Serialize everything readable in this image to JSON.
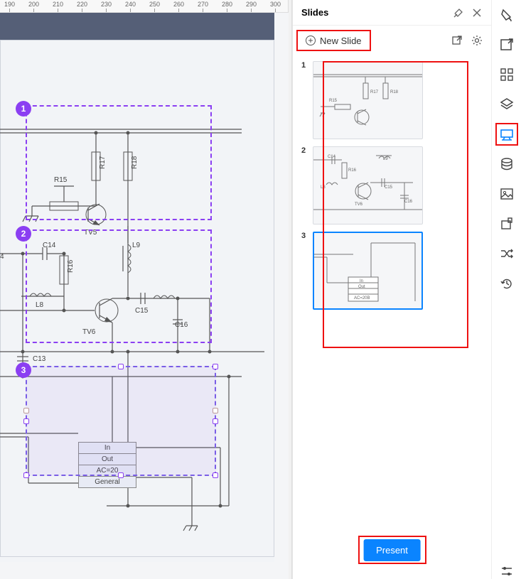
{
  "ruler_ticks": [
    "190",
    "200",
    "210",
    "220",
    "230",
    "240",
    "250",
    "260",
    "270",
    "280",
    "290",
    "300"
  ],
  "panel": {
    "title": "Slides",
    "new_slide": "New Slide",
    "present": "Present"
  },
  "markers": [
    "1",
    "2",
    "3"
  ],
  "block": {
    "row1": "In",
    "row2": "Out",
    "row3": "AC=20",
    "row4": "General"
  },
  "labels": {
    "r15": "R15",
    "r16": "R16",
    "r17": "R17",
    "r18": "R18",
    "tv5": "TV5",
    "tv6": "TV6",
    "l8": "L8",
    "l9": "L9",
    "c13": "C13",
    "c14": "C14",
    "c15": "C15",
    "c16": "C16",
    "four": "4"
  },
  "thumbs": [
    {
      "num": "1"
    },
    {
      "num": "2"
    },
    {
      "num": "3"
    }
  ]
}
